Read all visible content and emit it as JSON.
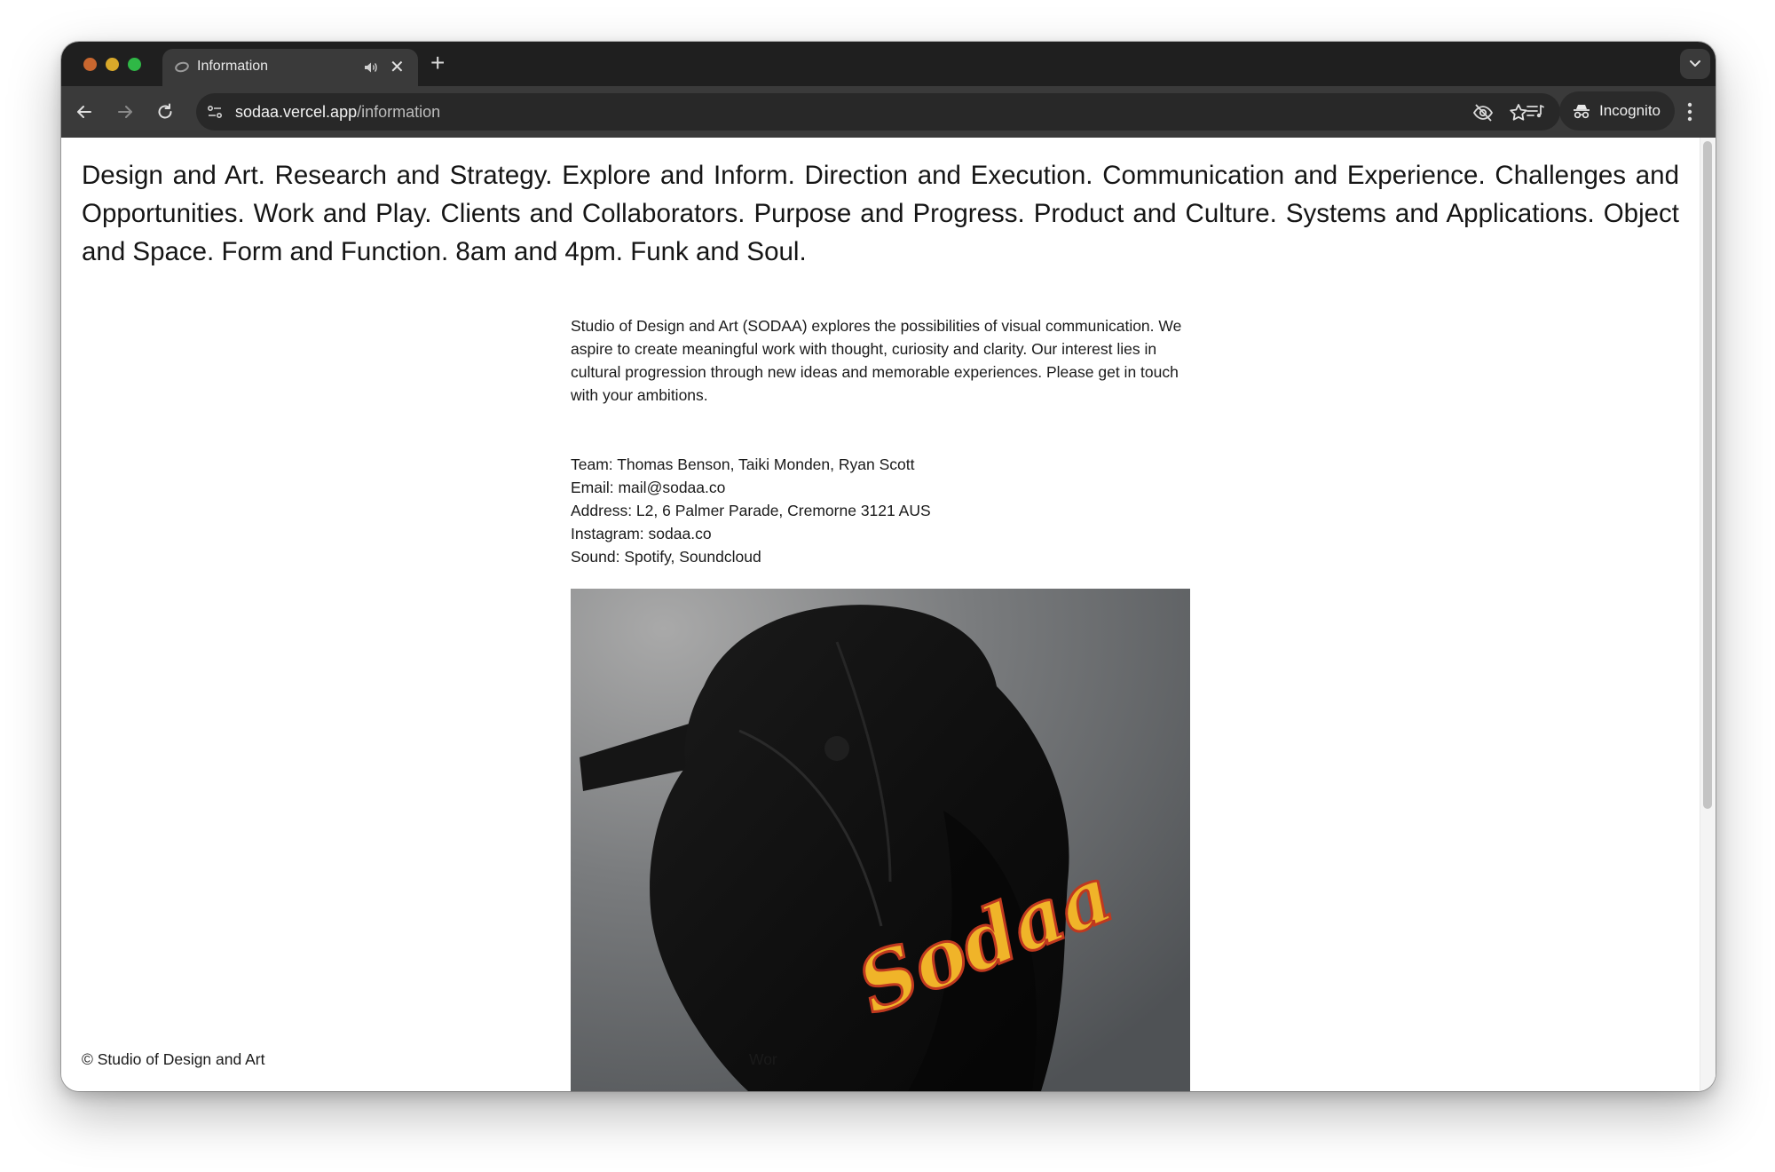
{
  "browser": {
    "tab_title": "Information",
    "tab_close": "✕",
    "new_tab": "+",
    "url_host": "sodaa.vercel.app",
    "url_path": "/information",
    "incognito_label": "Incognito"
  },
  "page": {
    "headline": "Design and Art. Research and Strategy. Explore and Inform. Direction and Execution. Communication and Experience. Challenges and Opportunities. Work and Play. Clients and Collaborators. Purpose and Progress. Product and Culture. Systems and Applications. Object and Space. Form and Function. 8am and 4pm. Funk and Soul.",
    "intro": "Studio of Design and Art (SODAA) explores the possibilities of visual communication. We aspire to create meaningful work with thought, curiosity and clarity. Our interest lies in cultural progression through new ideas and memorable experiences. Please get in touch with your ambitions.",
    "contact": {
      "team": "Team: Thomas Benson, Taiki Monden, Ryan Scott",
      "email": "Email: mail@sodaa.co",
      "address": "Address: L2, 6 Palmer Parade, Cremorne 3121 AUS",
      "instagram": "Instagram: sodaa.co",
      "sound": "Sound: Spotify, Soundcloud"
    },
    "cap_logo_text": "Sodaa",
    "footer_left": "© Studio of Design and Art",
    "footer_center": "Wor"
  },
  "colors": {
    "tabstrip": "#1f1f1f",
    "toolbar": "#3a3a3a",
    "cap_logo": "#f0b429"
  }
}
